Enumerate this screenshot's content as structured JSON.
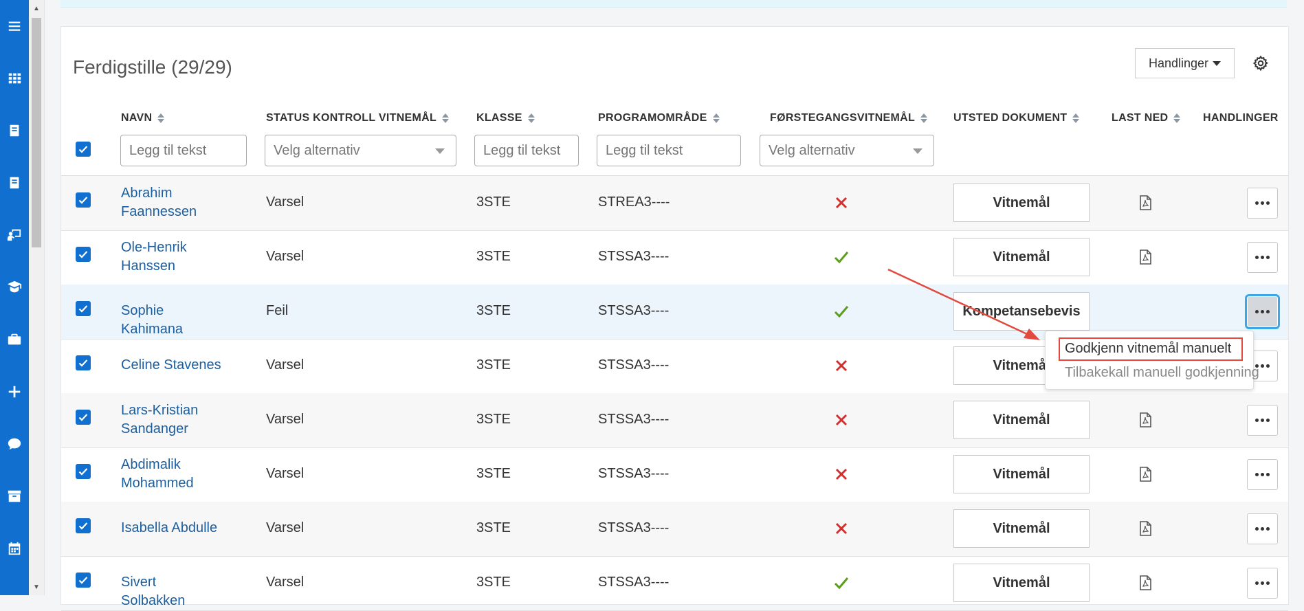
{
  "card": {
    "title": "Ferdigstille (29/29)",
    "actions_label": "Handlinger"
  },
  "columns": {
    "name": "NAVN",
    "status": "STATUS KONTROLL VITNEMÅL",
    "class": "KLASSE",
    "program": "PROGRAMOMRÅDE",
    "first": "FØRSTEGANGSVITNEMÅL",
    "issue": "UTSTED DOKUMENT",
    "download": "LAST NED",
    "actions": "HANDLINGER"
  },
  "filters": {
    "name_placeholder": "Legg til tekst",
    "status_placeholder": "Velg alternativ",
    "class_placeholder": "Legg til tekst",
    "program_placeholder": "Legg til tekst",
    "first_placeholder": "Velg alternativ"
  },
  "rows": [
    {
      "name": "Abrahim Faannessen",
      "status": "Varsel",
      "class": "3STE",
      "program": "STREA3----",
      "first": "no",
      "doc": "Vitnemål",
      "pdf": true
    },
    {
      "name": "Ole-Henrik Hanssen",
      "status": "Varsel",
      "class": "3STE",
      "program": "STSSA3----",
      "first": "yes",
      "doc": "Vitnemål",
      "pdf": true
    },
    {
      "name": "Sophie Kahimana",
      "status": "Feil",
      "class": "3STE",
      "program": "STSSA3----",
      "first": "yes",
      "doc": "Kompetansebevis",
      "pdf": false
    },
    {
      "name": "Celine Stavenes",
      "status": "Varsel",
      "class": "3STE",
      "program": "STSSA3----",
      "first": "no",
      "doc": "Vitnemål",
      "pdf": false
    },
    {
      "name": "Lars-Kristian Sandanger",
      "status": "Varsel",
      "class": "3STE",
      "program": "STSSA3----",
      "first": "no",
      "doc": "Vitnemål",
      "pdf": true
    },
    {
      "name": "Abdimalik Mohammed",
      "status": "Varsel",
      "class": "3STE",
      "program": "STSSA3----",
      "first": "no",
      "doc": "Vitnemål",
      "pdf": true
    },
    {
      "name": "Isabella Abdulle",
      "status": "Varsel",
      "class": "3STE",
      "program": "STSSA3----",
      "first": "no",
      "doc": "Vitnemål",
      "pdf": true
    },
    {
      "name": "Sivert Solbakken",
      "status": "Varsel",
      "class": "3STE",
      "program": "STSSA3----",
      "first": "yes",
      "doc": "Vitnemål",
      "pdf": true
    }
  ],
  "context_menu": {
    "approve": "Godkjenn vitnemål manuelt",
    "revoke": "Tilbakekall manuell godkjenning"
  },
  "sidebar_icons": [
    "menu-icon",
    "apps-grid-icon",
    "book-icon",
    "book-icon",
    "teacher-board-icon",
    "graduate-icon",
    "briefcase-icon",
    "plus-icon",
    "chat-icon",
    "archive-icon",
    "calendar-icon"
  ],
  "colors": {
    "brand": "#1170cf",
    "link": "#1d5f9e",
    "check_green": "#5a9e1c",
    "cross_red": "#d32f2f",
    "annotation_red": "#e04a3f"
  }
}
